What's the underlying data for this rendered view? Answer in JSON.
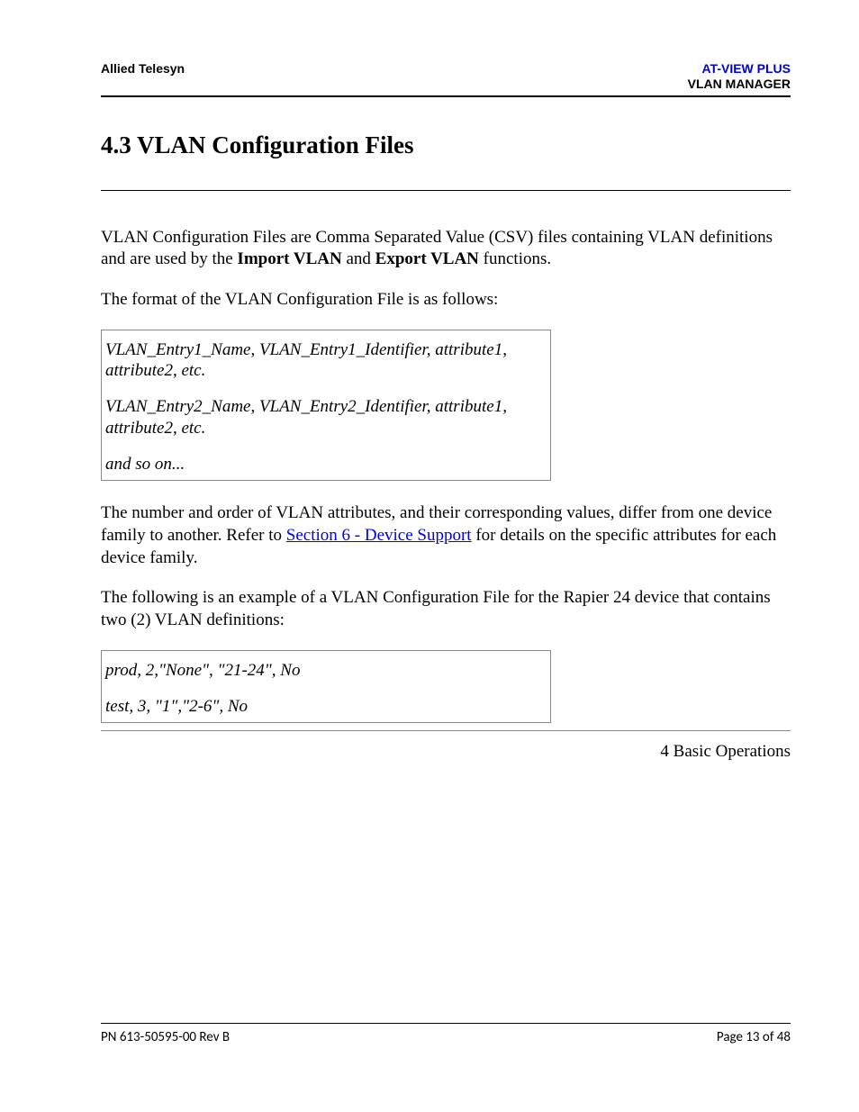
{
  "header": {
    "left": "Allied Telesyn",
    "right_line1": "AT-VIEW PLUS",
    "right_line2": "VLAN MANAGER"
  },
  "title": "4.3 VLAN Configuration Files",
  "para1_a": "VLAN Configuration Files are Comma Separated Value (CSV) files containing VLAN definitions and are used by the ",
  "para1_bold1": "Import VLAN",
  "para1_b": " and ",
  "para1_bold2": "Export VLAN",
  "para1_c": " functions.",
  "para2": "The format of the VLAN Configuration File is as follows:",
  "codebox1": {
    "line1": "VLAN_Entry1_Name, VLAN_Entry1_Identifier, attribute1, attribute2, etc.",
    "line2": "VLAN_Entry2_Name, VLAN_Entry2_Identifier, attribute1, attribute2, etc.",
    "line3": "and so on..."
  },
  "para3_a": "The number and order of VLAN attributes, and their corresponding values, differ from one device family to another. Refer to ",
  "para3_link": "Section 6 - Device Support",
  "para3_b": " for details on the specific attributes for each device family.",
  "para4": "The following is an example of a VLAN Configuration File for the Rapier 24 device that contains two (2) VLAN definitions:",
  "codebox2": {
    "line1": "prod, 2,\"None\", \"21-24\", No",
    "line2": "test, 3, \"1\",\"2-6\", No"
  },
  "rightline": "4 Basic Operations",
  "footer": {
    "left": "PN 613-50595-00 Rev B",
    "right": "Page 13 of 48"
  }
}
